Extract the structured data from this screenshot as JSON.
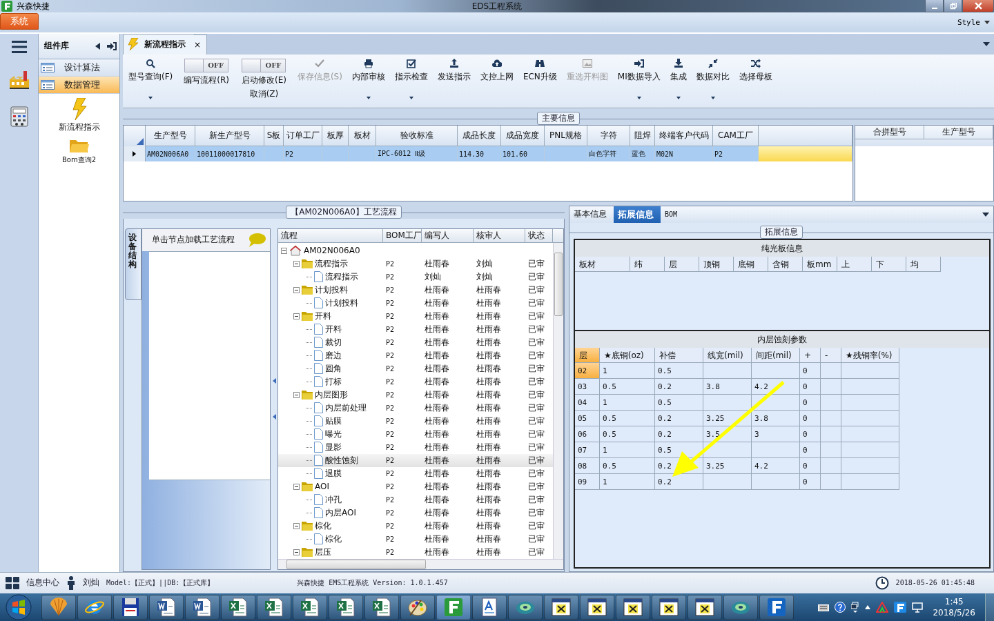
{
  "titlebar": {
    "app": "兴森快捷",
    "title": "EDS工程系统"
  },
  "menubar": {
    "tab": "系统",
    "style": "Style"
  },
  "component_panel": {
    "title": "组件库",
    "items": [
      {
        "label": "设计算法",
        "selected": false
      },
      {
        "label": "数据管理",
        "selected": true
      }
    ],
    "tools": [
      "新流程指示",
      "Bom查询2"
    ]
  },
  "doc_tab": {
    "label": "新流程指示",
    "close": "×"
  },
  "ribbon": [
    {
      "kind": "button",
      "label": "型号查询(F)",
      "dropdown": true,
      "disabled": false
    },
    {
      "kind": "toggle",
      "label": "编写流程(R)",
      "switch": "OFF",
      "on": false
    },
    {
      "kind": "toggle",
      "label": "启动修改(E)",
      "sublabel": "取消(Z)",
      "switch": "OFF",
      "on": false
    },
    {
      "kind": "button",
      "label": "保存信息(S)",
      "dropdown": false,
      "disabled": true
    },
    {
      "kind": "button",
      "label": "内部审核",
      "dropdown": true,
      "disabled": false
    },
    {
      "kind": "button",
      "label": "指示检查",
      "dropdown": true,
      "disabled": false
    },
    {
      "kind": "button",
      "label": "发送指示",
      "dropdown": false,
      "disabled": false
    },
    {
      "kind": "button",
      "label": "文控上网",
      "dropdown": false,
      "disabled": false
    },
    {
      "kind": "button",
      "label": "ECN升级",
      "dropdown": false,
      "disabled": false
    },
    {
      "kind": "button",
      "label": "重选开料图",
      "dropdown": false,
      "disabled": true
    },
    {
      "kind": "button",
      "label": "MI数据导入",
      "dropdown": true,
      "disabled": false
    },
    {
      "kind": "button",
      "label": "集成",
      "dropdown": true,
      "disabled": false
    },
    {
      "kind": "button",
      "label": "数据对比",
      "dropdown": true,
      "disabled": false
    },
    {
      "kind": "button",
      "label": "选择母板",
      "dropdown": false,
      "disabled": false
    }
  ],
  "main_info": {
    "legend": "主要信息",
    "columns": [
      "生产型号",
      "新生产型号",
      "S板",
      "订单工厂",
      "板厚",
      "板材",
      "验收标准",
      "成品长度",
      "成品宽度",
      "PNL规格",
      "字符",
      "阻焊",
      "终端客户代码",
      "CAM工厂"
    ],
    "rows": [
      {
        "selected": true,
        "cells": [
          "AM02N006A0",
          "10011000017810",
          null,
          "P2",
          null,
          null,
          "IPC-6012 Ⅱ级",
          "114.30",
          "101.60",
          null,
          "白色字符",
          "蓝色",
          "M02N",
          "P2"
        ]
      }
    ],
    "side_columns": [
      "合拼型号",
      "生产型号"
    ]
  },
  "process": {
    "legend": "【AM02N006A0】工艺流程",
    "side_tab": "设备结构",
    "hint": "单击节点加载工艺流程",
    "columns": [
      "流程",
      "BOM工厂",
      "编写人",
      "核审人",
      "状态"
    ],
    "tree": [
      {
        "label": "AM02N006A0",
        "selected": false,
        "expanded": true,
        "children": [
          {
            "label": "流程指示",
            "bom": "P2",
            "writer": "杜雨春",
            "reviewer": "刘灿",
            "status": "已审",
            "selected": false,
            "expanded": true,
            "children": [
              {
                "label": "流程指示",
                "bom": "P2",
                "writer": "刘灿",
                "reviewer": "刘灿",
                "status": "已审",
                "selected": false
              }
            ]
          },
          {
            "label": "计划投料",
            "bom": "P2",
            "writer": "杜雨春",
            "reviewer": "杜雨春",
            "status": "已审",
            "selected": false,
            "expanded": true,
            "children": [
              {
                "label": "计划投料",
                "bom": "P2",
                "writer": "杜雨春",
                "reviewer": "杜雨春",
                "status": "已审",
                "selected": false
              }
            ]
          },
          {
            "label": "开料",
            "bom": "P2",
            "writer": "杜雨春",
            "reviewer": "杜雨春",
            "status": "已审",
            "selected": false,
            "expanded": true,
            "children": [
              {
                "label": "开料",
                "bom": "P2",
                "writer": "杜雨春",
                "reviewer": "杜雨春",
                "status": "已审",
                "selected": false
              },
              {
                "label": "裁切",
                "bom": "P2",
                "writer": "杜雨春",
                "reviewer": "杜雨春",
                "status": "已审",
                "selected": false
              },
              {
                "label": "磨边",
                "bom": "P2",
                "writer": "杜雨春",
                "reviewer": "杜雨春",
                "status": "已审",
                "selected": false
              },
              {
                "label": "圆角",
                "bom": "P2",
                "writer": "杜雨春",
                "reviewer": "杜雨春",
                "status": "已审",
                "selected": false
              },
              {
                "label": "打标",
                "bom": "P2",
                "writer": "杜雨春",
                "reviewer": "杜雨春",
                "status": "已审",
                "selected": false
              }
            ]
          },
          {
            "label": "内层图形",
            "bom": "P2",
            "writer": "杜雨春",
            "reviewer": "杜雨春",
            "status": "已审",
            "selected": false,
            "expanded": true,
            "children": [
              {
                "label": "内层前处理",
                "bom": "P2",
                "writer": "杜雨春",
                "reviewer": "杜雨春",
                "status": "已审",
                "selected": false
              },
              {
                "label": "贴膜",
                "bom": "P2",
                "writer": "杜雨春",
                "reviewer": "杜雨春",
                "status": "已审",
                "selected": false
              },
              {
                "label": "曝光",
                "bom": "P2",
                "writer": "杜雨春",
                "reviewer": "杜雨春",
                "status": "已审",
                "selected": false
              },
              {
                "label": "显影",
                "bom": "P2",
                "writer": "杜雨春",
                "reviewer": "杜雨春",
                "status": "已审",
                "selected": false
              },
              {
                "label": "酸性蚀刻",
                "bom": "P2",
                "writer": "杜雨春",
                "reviewer": "杜雨春",
                "status": "已审",
                "selected": true
              },
              {
                "label": "退膜",
                "bom": "P2",
                "writer": "杜雨春",
                "reviewer": "杜雨春",
                "status": "已审",
                "selected": false
              }
            ]
          },
          {
            "label": "AOI",
            "bom": "P2",
            "writer": "杜雨春",
            "reviewer": "杜雨春",
            "status": "已审",
            "selected": false,
            "expanded": true,
            "children": [
              {
                "label": "冲孔",
                "bom": "P2",
                "writer": "杜雨春",
                "reviewer": "杜雨春",
                "status": "已审",
                "selected": false
              },
              {
                "label": "内层AOI",
                "bom": "P2",
                "writer": "杜雨春",
                "reviewer": "杜雨春",
                "status": "已审",
                "selected": false
              }
            ]
          },
          {
            "label": "棕化",
            "bom": "P2",
            "writer": "杜雨春",
            "reviewer": "杜雨春",
            "status": "已审",
            "selected": false,
            "expanded": true,
            "children": [
              {
                "label": "棕化",
                "bom": "P2",
                "writer": "杜雨春",
                "reviewer": "杜雨春",
                "status": "已审",
                "selected": false
              }
            ]
          },
          {
            "label": "层压",
            "bom": "P2",
            "writer": "杜雨春",
            "reviewer": "杜雨春",
            "status": "已审",
            "selected": false,
            "expanded": true
          }
        ]
      }
    ]
  },
  "detail": {
    "tabs": [
      {
        "label": "基本信息",
        "selected": false
      },
      {
        "label": "拓展信息",
        "selected": true
      },
      {
        "label": "BOM",
        "selected": false
      }
    ],
    "legend": "拓展信息",
    "plain_board": {
      "title": "纯光板信息",
      "columns": [
        "板材",
        "纬",
        "层",
        "顶铜",
        "底铜",
        "含铜",
        "板mm",
        "上",
        "下",
        "均"
      ]
    },
    "inner_etch": {
      "title": "内层蚀刻参数",
      "columns": [
        "层",
        "★底铜(oz)",
        "补偿",
        "线宽(mil)",
        "间距(mil)",
        "+",
        "-",
        "★残铜率(%)"
      ],
      "rows": [
        {
          "selected": true,
          "cells": [
            "02",
            "1",
            "0.5",
            null,
            null,
            "0",
            null,
            null
          ]
        },
        {
          "selected": false,
          "cells": [
            "03",
            "0.5",
            "0.2",
            "3.8",
            "4.2",
            "0",
            null,
            null
          ]
        },
        {
          "selected": false,
          "cells": [
            "04",
            "1",
            "0.5",
            null,
            null,
            "0",
            null,
            null
          ]
        },
        {
          "selected": false,
          "cells": [
            "05",
            "0.5",
            "0.2",
            "3.25",
            "3.8",
            "0",
            null,
            null
          ]
        },
        {
          "selected": false,
          "cells": [
            "06",
            "0.5",
            "0.2",
            "3.5",
            "3",
            "0",
            null,
            null
          ]
        },
        {
          "selected": false,
          "cells": [
            "07",
            "1",
            "0.5",
            null,
            null,
            "0",
            null,
            null
          ]
        },
        {
          "selected": false,
          "cells": [
            "08",
            "0.5",
            "0.2",
            "3.25",
            "4.2",
            "0",
            null,
            null
          ]
        },
        {
          "selected": false,
          "cells": [
            "09",
            "1",
            "0.2",
            null,
            null,
            "0",
            null,
            null
          ]
        }
      ]
    }
  },
  "status_bar": {
    "info": "信息中心",
    "user": "刘灿",
    "model": "Model:【正式】||DB:【正式库】",
    "version": "兴森快捷 EMS工程系统 Version: 1.0.1.457",
    "datetime": "2018-05-26 01:45:48"
  },
  "taskbar": {
    "time": "1:45",
    "date": "2018/5/26"
  }
}
